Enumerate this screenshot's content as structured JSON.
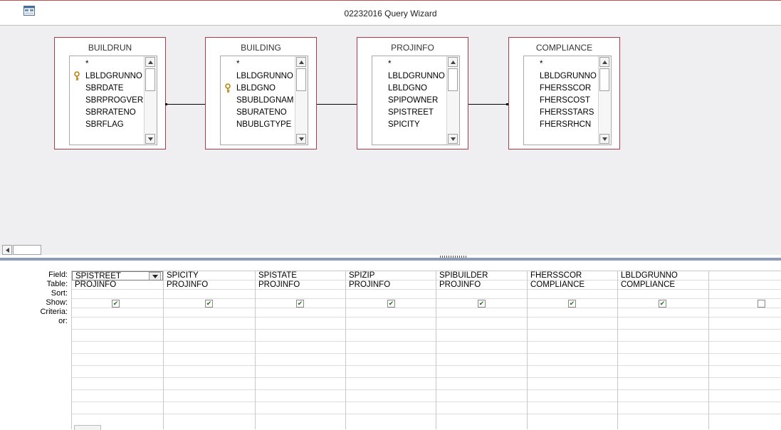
{
  "window": {
    "title": "02232016 Query Wizard",
    "app_icon": "query-design-icon",
    "accent_color": "#c0504d"
  },
  "diagram": {
    "tables": [
      {
        "name": "BUILDRUN",
        "fields": [
          "*",
          "LBLDGRUNNO",
          "SBRDATE",
          "SBRPROGVER",
          "SBRRATENO",
          "SBRFLAG"
        ],
        "key_field_index": 1
      },
      {
        "name": "BUILDING",
        "fields": [
          "*",
          "",
          "LBLDGRUNNO",
          "LBLDGNO",
          "SBUBLDGNAM",
          "SBURATENO",
          "NBUBLGTYPE"
        ],
        "key_field_index": 3
      },
      {
        "name": "PROJINFO",
        "fields": [
          "*",
          "",
          "LBLDGRUNNO",
          "LBLDGNO",
          "SPIPOWNER",
          "SPISTREET",
          "SPICITY"
        ],
        "key_field_index": -1
      },
      {
        "name": "COMPLIANCE",
        "fields": [
          "*",
          "LBLDGRUNNO",
          "FHERSSCOR",
          "FHERSCOST",
          "FHERSSTARS",
          "FHERSRHCN"
        ],
        "key_field_index": -1
      }
    ],
    "table_border_color": "#b23a48",
    "background_color": "#efeff1"
  },
  "grid": {
    "row_labels": [
      "Field:",
      "Table:",
      "Sort:",
      "Show:",
      "Criteria:",
      "or:"
    ],
    "columns": [
      {
        "field": "SPISTREET",
        "table": "PROJINFO",
        "show": true,
        "has_dropdown": true
      },
      {
        "field": "SPICITY",
        "table": "PROJINFO",
        "show": true
      },
      {
        "field": "SPISTATE",
        "table": "PROJINFO",
        "show": true
      },
      {
        "field": "SPIZIP",
        "table": "PROJINFO",
        "show": true
      },
      {
        "field": "SPIBUILDER",
        "table": "PROJINFO",
        "show": true
      },
      {
        "field": "FHERSSCOR",
        "table": "COMPLIANCE",
        "show": true
      },
      {
        "field": "LBLDGRUNNO",
        "table": "COMPLIANCE",
        "show": true
      },
      {
        "field": "",
        "table": "",
        "show": false
      }
    ]
  }
}
